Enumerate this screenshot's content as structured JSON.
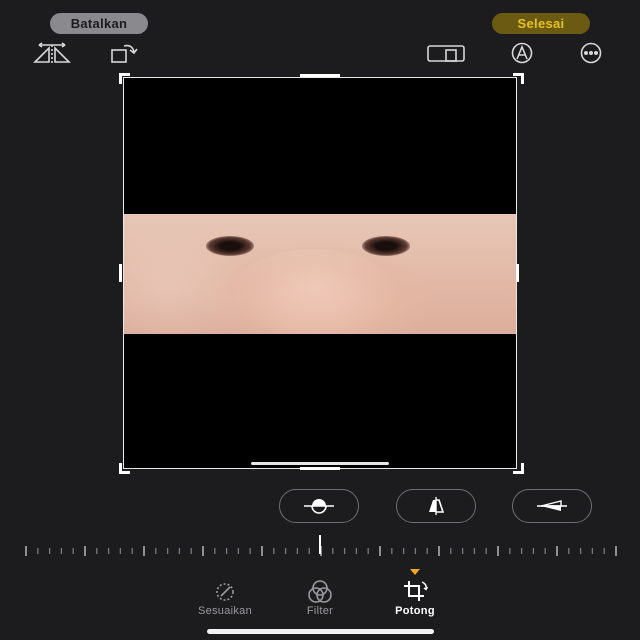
{
  "header": {
    "cancel_label": "Batalkan",
    "done_label": "Selesai"
  },
  "colors": {
    "background": "#1c1c1e",
    "accent": "#f5a623",
    "done_text": "#e6c21f"
  },
  "toolbar": {
    "left_tools": [
      "flip-icon",
      "rotate-icon"
    ],
    "right_tools": [
      "aspect-ratio-icon",
      "markup-icon",
      "more-icon"
    ]
  },
  "perspective": {
    "options": [
      "straighten-icon",
      "vertical-perspective-icon",
      "horizontal-perspective-icon"
    ]
  },
  "tabs": [
    {
      "label": "Sesuaikan",
      "icon": "adjust-icon",
      "active": false
    },
    {
      "label": "Filter",
      "icon": "filter-icon",
      "active": false
    },
    {
      "label": "Potong",
      "icon": "crop-icon",
      "active": true
    }
  ]
}
